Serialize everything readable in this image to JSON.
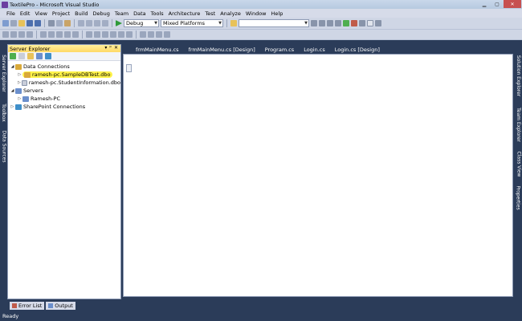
{
  "window": {
    "title": "TextilePro - Microsoft Visual Studio"
  },
  "menu": [
    "File",
    "Edit",
    "View",
    "Project",
    "Build",
    "Debug",
    "Team",
    "Data",
    "Tools",
    "Architecture",
    "Test",
    "Analyze",
    "Window",
    "Help"
  ],
  "toolbar": {
    "config": "Debug",
    "platform": "Mixed Platforms",
    "search_value": ""
  },
  "left_vertical_tabs": [
    "Server Explorer",
    "Toolbox",
    "Data Sources"
  ],
  "right_vertical_tabs": [
    "Solution Explorer",
    "Team Explorer",
    "Class View",
    "Properties"
  ],
  "server_explorer": {
    "title": "Server Explorer",
    "header_controls": [
      "▾",
      "ᵖ",
      "✕"
    ],
    "tree": [
      {
        "label": "Data Connections",
        "expander": "◢"
      },
      {
        "label": "ramesh-pc.SampleDBTest.dbo",
        "expander": "▷"
      },
      {
        "label": "ramesh-pc.StudentInformation.dbo",
        "expander": "▷"
      },
      {
        "label": "Servers",
        "expander": "◢"
      },
      {
        "label": "Ramesh-PC",
        "expander": "▷"
      },
      {
        "label": "SharePoint Connections",
        "expander": "▷"
      }
    ]
  },
  "doc_tabs": [
    "frmMainMenu.cs",
    "frmMainMenu.cs [Design]",
    "Program.cs",
    "Login.cs",
    "Login.cs [Design]"
  ],
  "bottom_tabs": [
    "Error List",
    "Output"
  ],
  "status": "Ready",
  "colors": {
    "highlight": "#fff34a",
    "panel_header": "#ffd965",
    "ide_dark": "#2b3c59"
  }
}
